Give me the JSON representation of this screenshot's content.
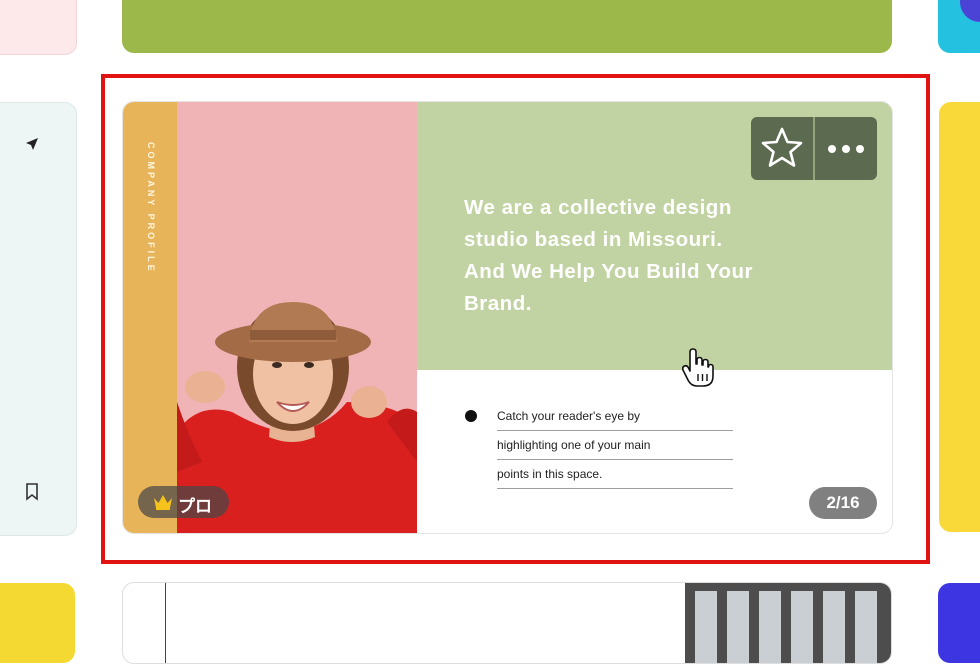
{
  "card": {
    "side_label": "COMPANY PROFILE",
    "headline": "We are a collective design\nstudio based in Missouri.\nAnd We Help You Build Your\nBrand.",
    "bullet_lines": [
      "Catch your reader's eye by",
      "highlighting one of your main",
      "points in this space."
    ],
    "pro_badge": "プロ",
    "page_counter": "2/16"
  },
  "icons": {
    "favorite": "star-icon",
    "more": "more-options-icon",
    "pro": "crown-icon",
    "cursor": "hand-pointer-icon",
    "left_panel_top": "navigation-arrow-icon",
    "left_panel_bottom": "bookmark-icon"
  },
  "colors": {
    "selection": "#e01212",
    "headline_panel": "#c2d3a3",
    "side_strip": "#e8b45a",
    "photo_background": "#f1b4b6",
    "sweater": "#d9201f"
  }
}
